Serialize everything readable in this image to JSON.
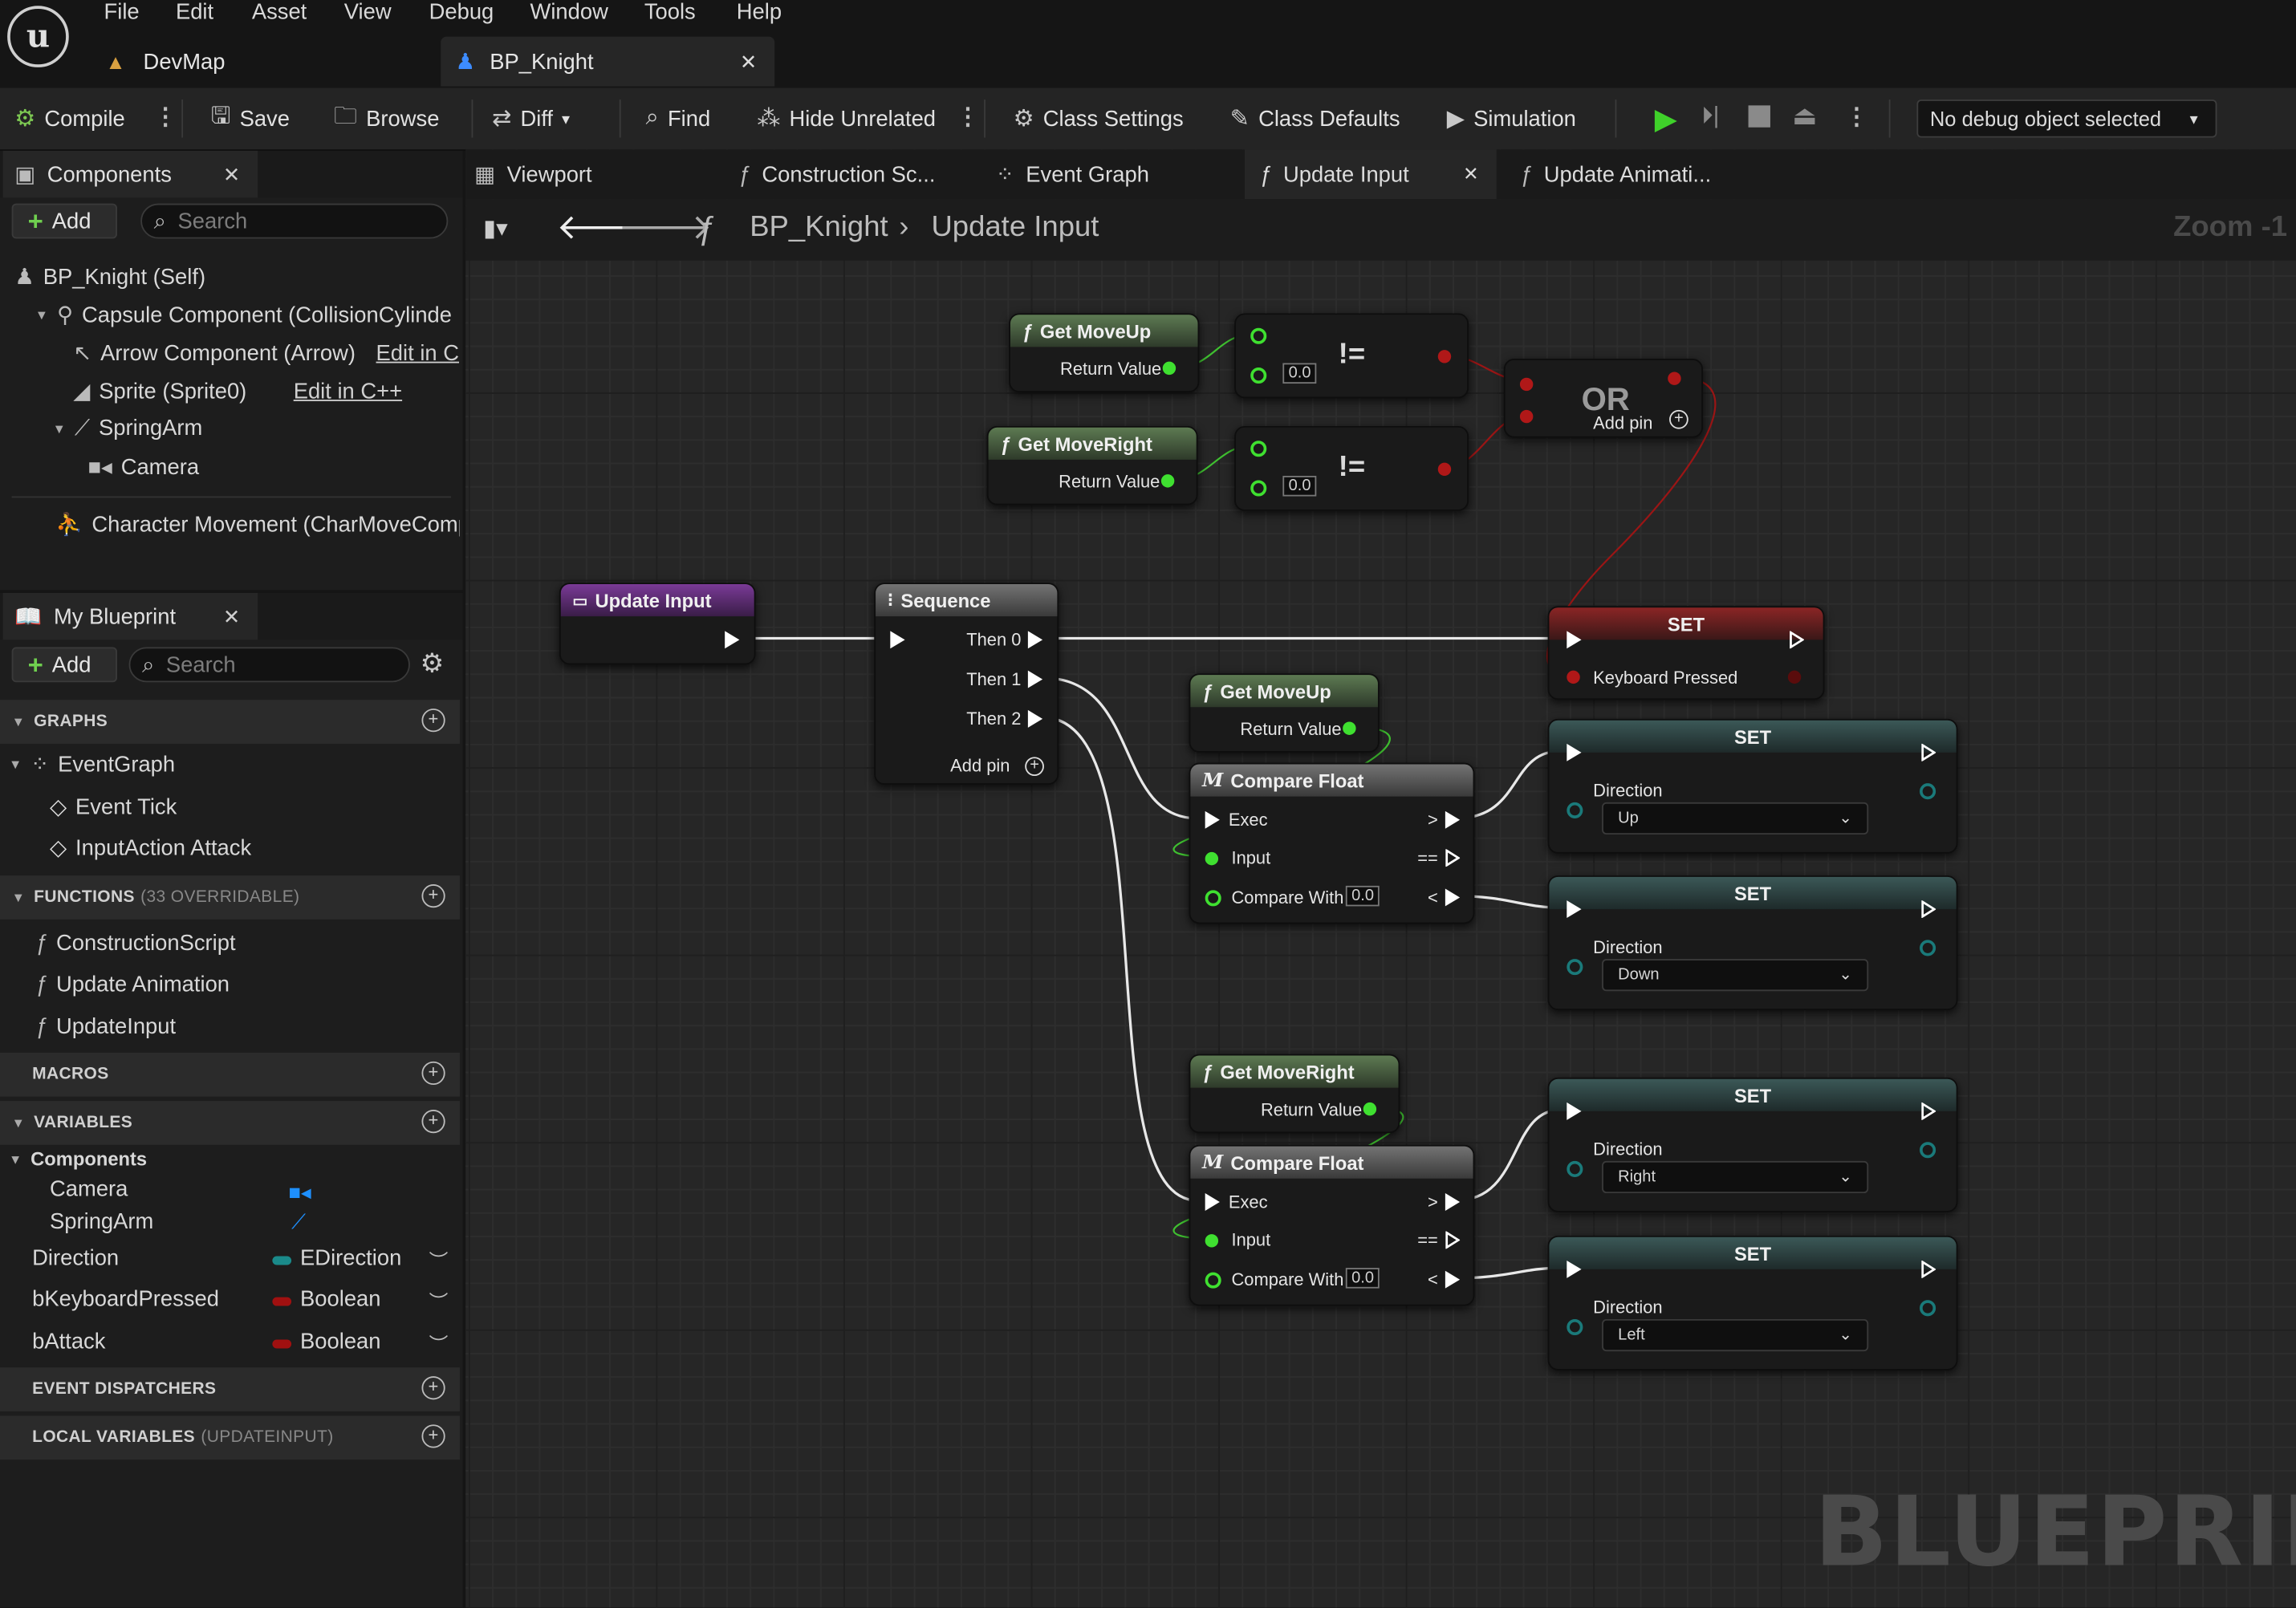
{
  "menu": [
    "File",
    "Edit",
    "Asset",
    "View",
    "Debug",
    "Window",
    "Tools",
    "Help"
  ],
  "document_tabs": [
    {
      "label": "DevMap"
    },
    {
      "label": "BP_Knight"
    }
  ],
  "toolbar": {
    "compile": "Compile",
    "save": "Save",
    "browse": "Browse",
    "diff": "Diff",
    "find": "Find",
    "hide_unrelated": "Hide Unrelated",
    "class_settings": "Class Settings",
    "class_defaults": "Class Defaults",
    "simulation": "Simulation",
    "debug_object": "No debug object selected"
  },
  "components_panel": {
    "title": "Components",
    "add": "Add",
    "search_placeholder": "Search",
    "items": [
      {
        "label": "BP_Knight (Self)"
      },
      {
        "label": "Capsule Component (CollisionCylinde"
      },
      {
        "label": "Arrow Component (Arrow)",
        "edit": "Edit in C"
      },
      {
        "label": "Sprite (Sprite0)",
        "edit": "Edit in C++"
      },
      {
        "label": "SpringArm"
      },
      {
        "label": "Camera"
      },
      {
        "label": "Character Movement (CharMoveComp"
      }
    ]
  },
  "my_blueprint": {
    "title": "My Blueprint",
    "add": "Add",
    "search_placeholder": "Search",
    "sections": {
      "graphs": "GRAPHS",
      "functions": "FUNCTIONS",
      "functions_count": "(33 OVERRIDABLE)",
      "macros": "MACROS",
      "variables": "VARIABLES",
      "event_dispatchers": "EVENT DISPATCHERS",
      "local_variables": "LOCAL VARIABLES",
      "local_variables_scope": "(UPDATEINPUT)"
    },
    "graphs": [
      "EventGraph",
      "Event Tick",
      "InputAction Attack"
    ],
    "functions": [
      "ConstructionScript",
      "Update Animation",
      "UpdateInput"
    ],
    "variable_category": "Components",
    "component_vars": [
      "Camera",
      "SpringArm"
    ],
    "variables": [
      {
        "name": "Direction",
        "type": "EDirection",
        "color": "#1a8a8a"
      },
      {
        "name": "bKeyboardPressed",
        "type": "Boolean",
        "color": "#a01010"
      },
      {
        "name": "bAttack",
        "type": "Boolean",
        "color": "#a01010"
      }
    ]
  },
  "graph_tabs": [
    "Viewport",
    "Construction Sc...",
    "Event Graph",
    "Update Input",
    "Update Animati..."
  ],
  "breadcrumb": {
    "root": "BP_Knight",
    "current": "Update Input",
    "zoom": "Zoom -1"
  },
  "watermark": "BLUEPRINT",
  "nodes": {
    "get_moveup_1": {
      "title": "Get MoveUp",
      "out": "Return Value"
    },
    "get_moveright_1": {
      "title": "Get MoveRight",
      "out": "Return Value"
    },
    "neq_value": "0.0",
    "or_node": {
      "title": "OR",
      "add_pin": "Add pin"
    },
    "update_input": {
      "title": "Update Input"
    },
    "sequence": {
      "title": "Sequence",
      "outs": [
        "Then 0",
        "Then 1",
        "Then 2"
      ],
      "add_pin": "Add pin"
    },
    "set_keyboard": {
      "title": "SET",
      "var": "Keyboard Pressed"
    },
    "get_moveup_2": {
      "title": "Get MoveUp",
      "out": "Return Value"
    },
    "compare_float_1": {
      "title": "Compare Float",
      "exec": "Exec",
      "input": "Input",
      "compare_with": "Compare With",
      "value": "0.0",
      "gt": ">",
      "eq": "==",
      "lt": "<"
    },
    "get_moveright_2": {
      "title": "Get MoveRight",
      "out": "Return Value"
    },
    "compare_float_2": {
      "title": "Compare Float",
      "exec": "Exec",
      "input": "Input",
      "compare_with": "Compare With",
      "value": "0.0",
      "gt": ">",
      "eq": "==",
      "lt": "<"
    },
    "set_nodes": [
      {
        "title": "SET",
        "var": "Direction",
        "value": "Up"
      },
      {
        "title": "SET",
        "var": "Direction",
        "value": "Down"
      },
      {
        "title": "SET",
        "var": "Direction",
        "value": "Right"
      },
      {
        "title": "SET",
        "var": "Direction",
        "value": "Left"
      }
    ]
  }
}
